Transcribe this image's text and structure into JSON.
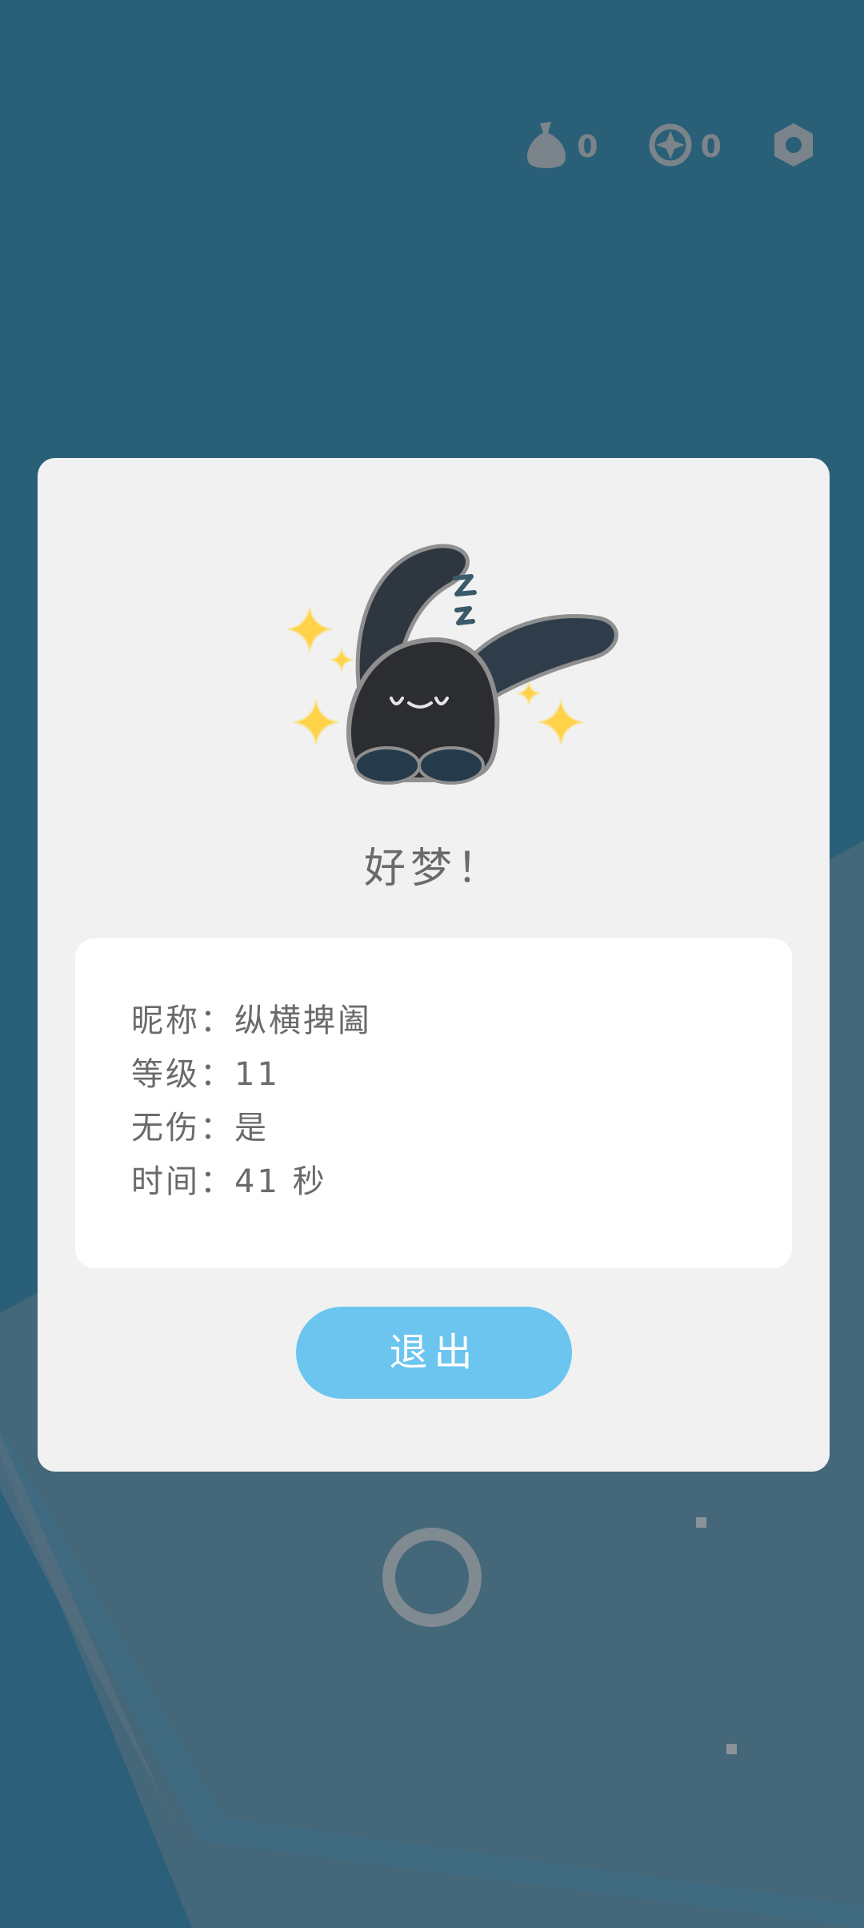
{
  "hud": {
    "items": [
      {
        "icon": "coin-bag-icon",
        "count": "0"
      },
      {
        "icon": "compass-icon",
        "count": "0"
      },
      {
        "icon": "settings-hexagon-icon",
        "count": ""
      }
    ]
  },
  "dialog": {
    "title": "好梦！",
    "illustration": "sleeping-bunny-with-sparkles",
    "info": [
      {
        "label": "昵称",
        "value": "纵横捭阖"
      },
      {
        "label": "等级",
        "value": "11"
      },
      {
        "label": "无伤",
        "value": "是"
      },
      {
        "label": "时间",
        "value": "41 秒"
      }
    ],
    "separator": "：",
    "exit_label": "退出"
  },
  "colors": {
    "background": "#2a5f78",
    "dialog": "#f1f1f1",
    "card": "#ffffff",
    "button": "#6bc5ef",
    "text": "#6a6a6a"
  }
}
